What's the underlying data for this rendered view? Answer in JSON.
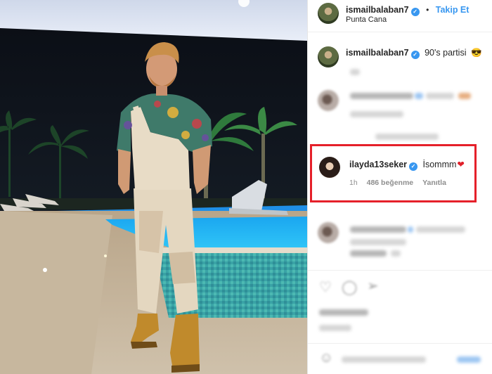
{
  "post": {
    "author": "ismailbalaban7",
    "follow_label": "Takip Et",
    "separator": "•",
    "location": "Punta Cana",
    "caption_user": "ismailbalaban7",
    "caption_text": "90's partisi",
    "caption_emoji": "😎"
  },
  "highlighted_comment": {
    "user": "ilayda13seker",
    "text": "İsommm",
    "heart": "❤",
    "time": "1h",
    "likes": "486 beğenme",
    "reply_label": "Yanıtla"
  },
  "icons": {
    "verified": "verified-badge-icon",
    "heart": "heart-icon",
    "comment": "comment-icon",
    "share": "share-icon",
    "emoji": "emoji-icon"
  },
  "colors": {
    "link": "#3897f0",
    "highlight": "#e5202a",
    "text": "#262626",
    "muted": "#8e8e8e"
  }
}
